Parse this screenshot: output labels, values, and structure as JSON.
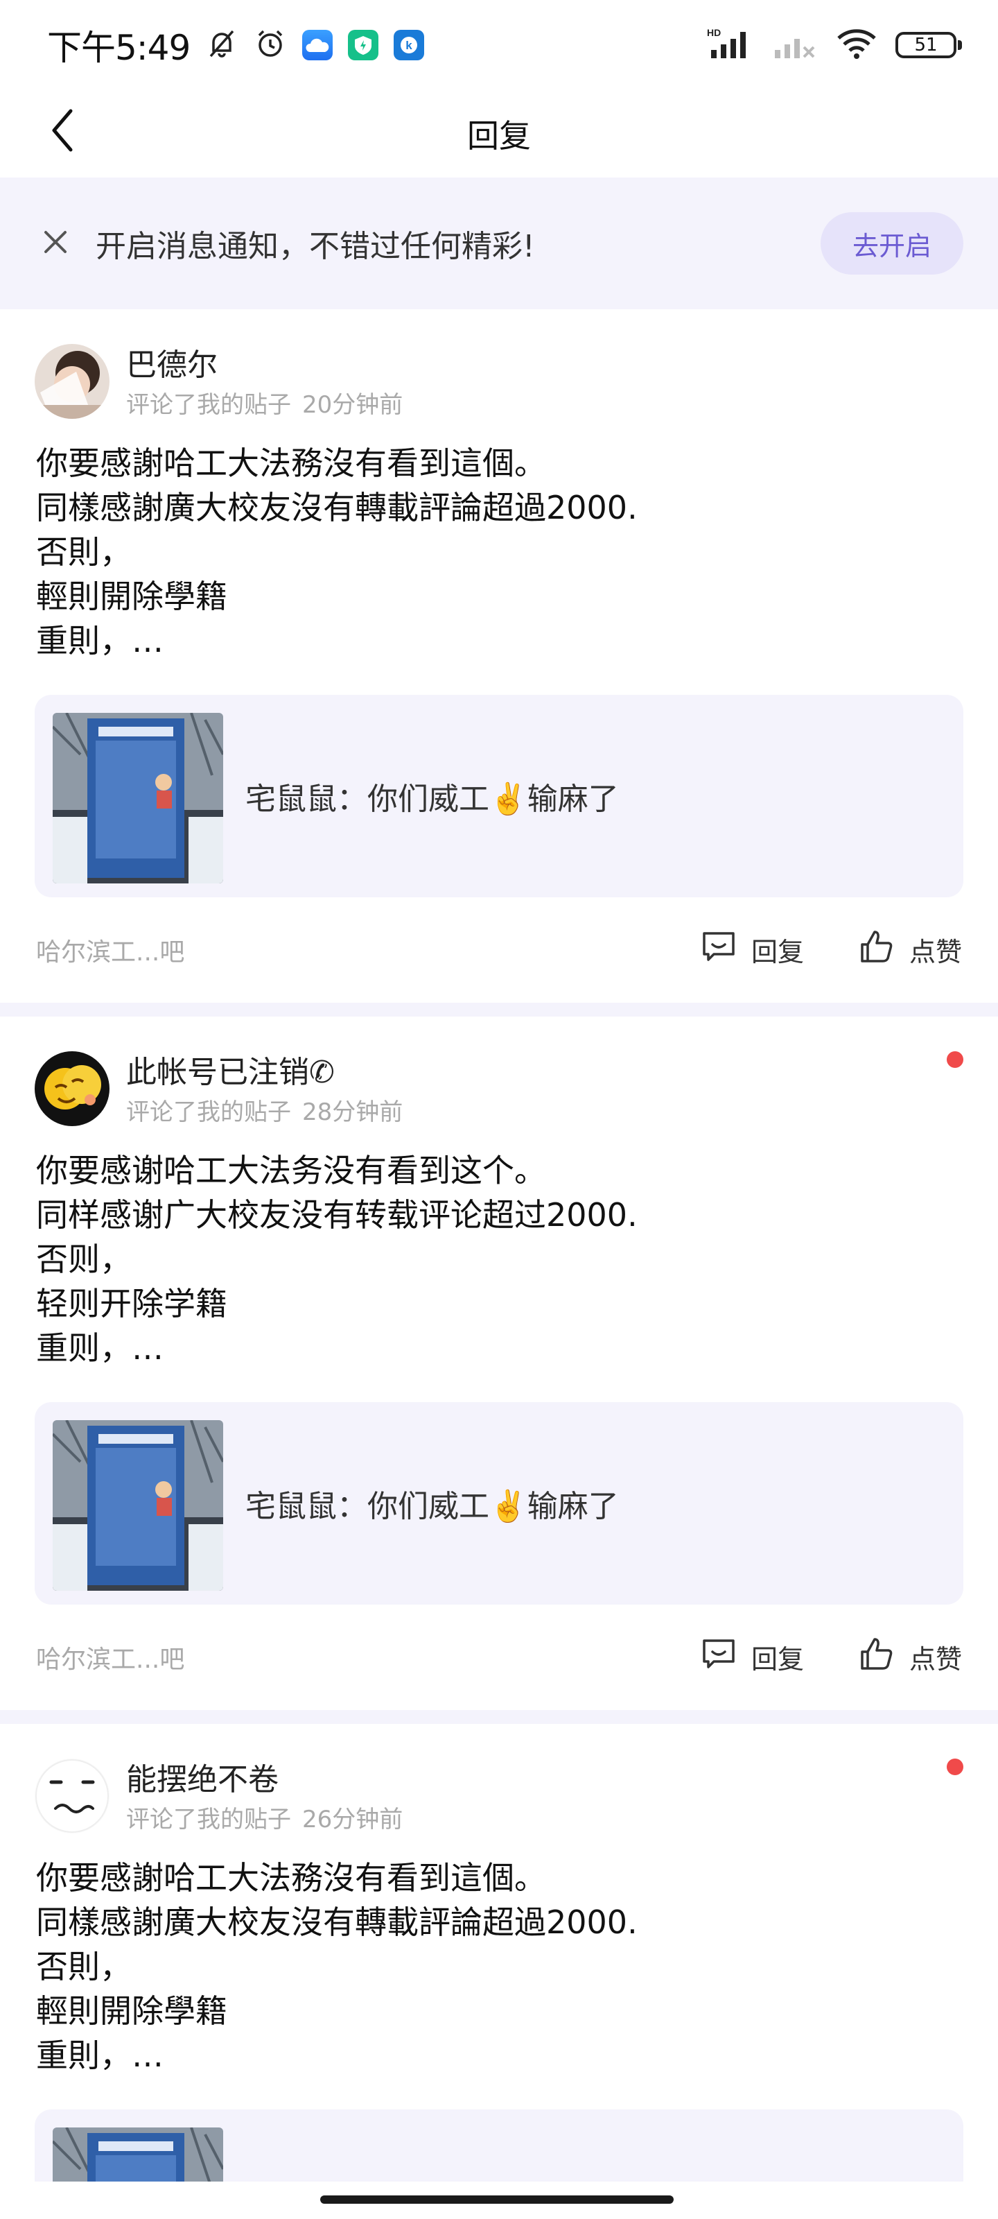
{
  "status_bar": {
    "time": "下午5:49",
    "hd_label": "HD",
    "battery": "51",
    "icons": [
      "mute-bell-icon",
      "alarm-icon",
      "app-cloud-icon",
      "app-green-icon",
      "app-k-icon",
      "signal-icon",
      "signal-off-icon",
      "wifi-icon",
      "battery-icon"
    ]
  },
  "header": {
    "title": "回复",
    "back_icon": "chevron-left-icon"
  },
  "notify_bar": {
    "text": "开启消息通知，不错过任何精彩!",
    "button": "去开启",
    "close_icon": "close-icon"
  },
  "replies": [
    {
      "user": "巴德尔",
      "action": "评论了我的贴子",
      "time": "20分钟前",
      "unread": false,
      "lines": [
        "你要感謝哈工大法務沒有看到這個。",
        "同樣感謝廣大校友沒有轉載評論超過2000.",
        "否則，",
        "輕則開除學籍",
        "重則，…"
      ],
      "quote": "宅鼠鼠：你们威工✌️输麻了",
      "source": "哈尔滨工...吧",
      "reply_label": "回复",
      "like_label": "点赞"
    },
    {
      "user": "此帐号已注销✆",
      "action": "评论了我的贴子",
      "time": "28分钟前",
      "unread": true,
      "lines": [
        "你要感谢哈工大法务没有看到这个。",
        "同样感谢广大校友没有转载评论超过2000.",
        "否则，",
        "轻则开除学籍",
        "重则，…"
      ],
      "quote": "宅鼠鼠：你们威工✌️输麻了",
      "source": "哈尔滨工...吧",
      "reply_label": "回复",
      "like_label": "点赞"
    },
    {
      "user": "能摆绝不卷",
      "action": "评论了我的贴子",
      "time": "26分钟前",
      "unread": true,
      "lines": [
        "你要感謝哈工大法務沒有看到這個。",
        "同樣感謝廣大校友沒有轉載評論超過2000.",
        "否則，",
        "輕則開除學籍",
        "重則，…"
      ]
    }
  ],
  "colors": {
    "accent": "#6b5bd2",
    "banner_bg": "#f4f3fc",
    "unread_dot": "#f04a4a",
    "muted_text": "#a9a9a9"
  }
}
